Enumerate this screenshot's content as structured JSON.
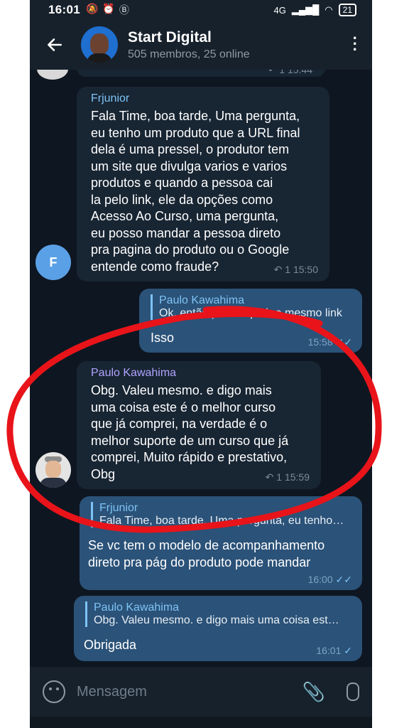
{
  "status_bar": {
    "time": "16:01",
    "network": "4G",
    "battery": "21"
  },
  "header": {
    "title": "Start Digital",
    "subtitle": "505 membros, 25 online"
  },
  "messages": [
    {
      "sender": "",
      "meta": "1  15:44"
    },
    {
      "sender": "Frjunior",
      "avatar_letter": "F",
      "lines": [
        "Fala Time, boa tarde, Uma pergunta,",
        "eu tenho um produto que a URL final",
        "dela é uma pressel, o produtor tem",
        "um site que divulga varios e varios",
        "produtos e quando a pessoa cai",
        "la pelo link, ele da opções como",
        "Acesso Ao Curso, uma pergunta,",
        "eu posso mandar a pessoa direto",
        "pra pagina do produto ou o Google",
        "entende como fraude?"
      ],
      "meta": "1  15:50"
    },
    {
      "reply_name": "Paulo Kawahima",
      "reply_text": "Ok. então pode repetir o mesmo link",
      "text": "Isso",
      "time": "15:58"
    },
    {
      "sender": "Paulo Kawahima",
      "lines": [
        "Obg. Valeu mesmo. e digo mais",
        "uma coisa este é o melhor curso",
        "que já comprei, na verdade é o",
        "melhor suporte de um curso que já",
        "comprei, Muito rápido e prestativo,",
        "Obg"
      ],
      "meta": "1  15:59"
    },
    {
      "reply_name": "Frjunior",
      "reply_text": "Fala Time, boa tarde, Uma pergunta, eu tenho…",
      "lines": [
        "Se vc tem o modelo de acompanhamento",
        "direto pra pág do produto pode mandar"
      ],
      "time": "16:00"
    },
    {
      "reply_name": "Paulo Kawahima",
      "reply_text": "Obg. Valeu mesmo. e digo mais uma coisa est…",
      "text": "Obrigada",
      "time": "16:01"
    }
  ],
  "composer": {
    "placeholder": "Mensagem"
  },
  "colors": {
    "annotation": "#e8141a",
    "outgoing": "#2b5278",
    "incoming": "#182533",
    "sender_blue": "#7ec3f5",
    "sender_purple": "#b1a4ff"
  },
  "icons": [
    "back-arrow-icon",
    "more-vertical-icon",
    "reply-arrow-icon",
    "double-check-icon",
    "single-check-icon",
    "emoji-icon",
    "paperclip-icon",
    "microphone-icon"
  ]
}
